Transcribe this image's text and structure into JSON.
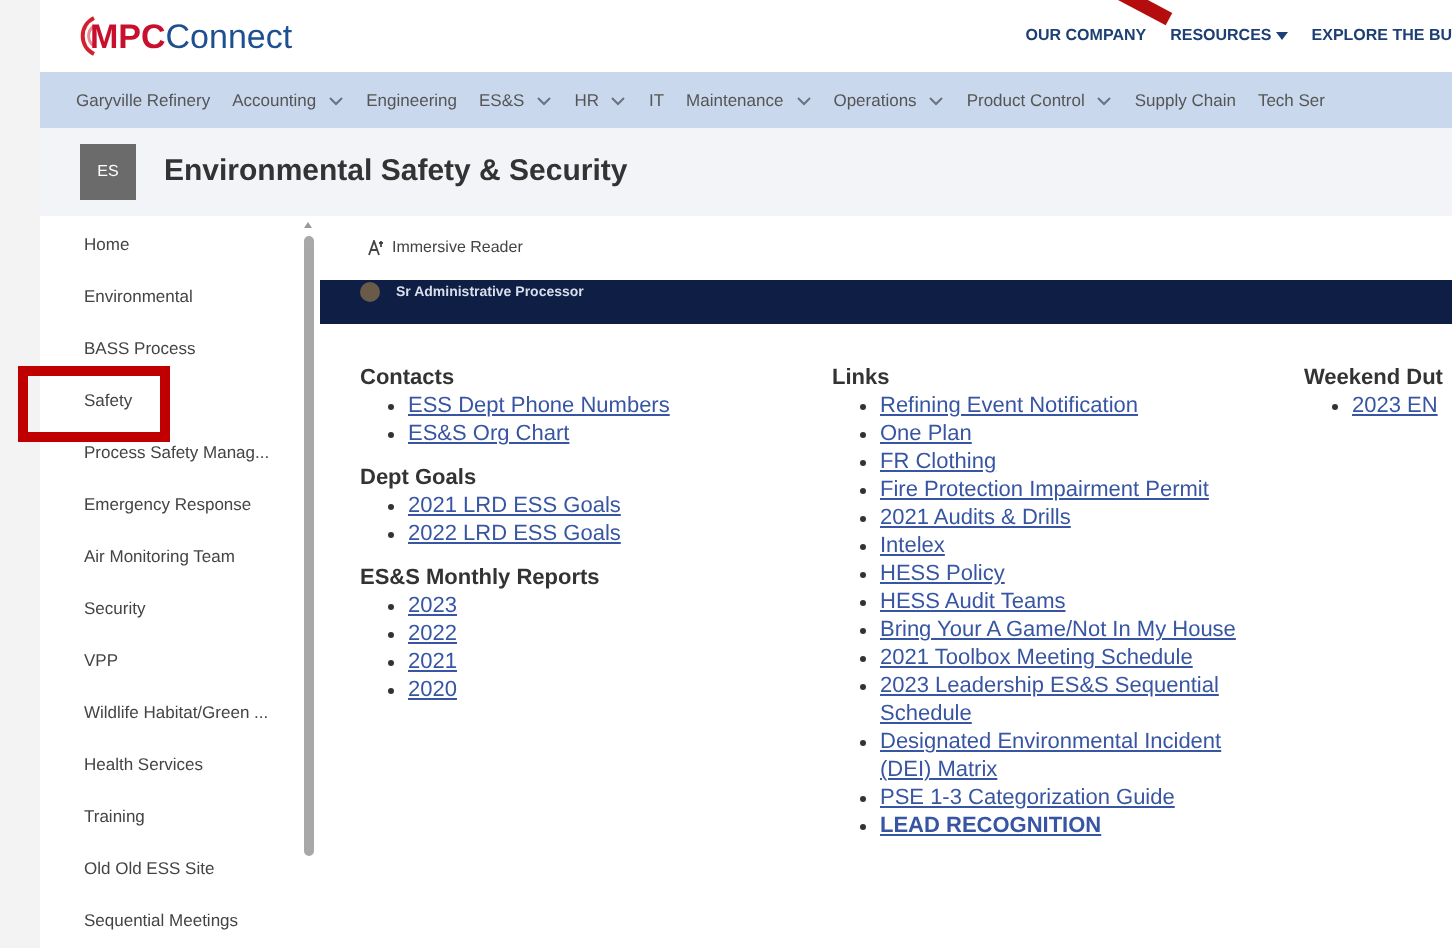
{
  "header": {
    "logo": {
      "mark": "MPC",
      "rest": "Connect"
    },
    "top_links": [
      {
        "label": "OUR COMPANY",
        "dropdown": false
      },
      {
        "label": "RESOURCES",
        "dropdown": true
      },
      {
        "label": "EXPLORE THE BU",
        "dropdown": false
      }
    ]
  },
  "nav": [
    {
      "label": "Garyville Refinery",
      "dropdown": false
    },
    {
      "label": "Accounting",
      "dropdown": true
    },
    {
      "label": "Engineering",
      "dropdown": false
    },
    {
      "label": "ES&S",
      "dropdown": true
    },
    {
      "label": "HR",
      "dropdown": true
    },
    {
      "label": "IT",
      "dropdown": false
    },
    {
      "label": "Maintenance",
      "dropdown": true
    },
    {
      "label": "Operations",
      "dropdown": true
    },
    {
      "label": "Product Control",
      "dropdown": true
    },
    {
      "label": "Supply Chain",
      "dropdown": false
    },
    {
      "label": "Tech Ser",
      "dropdown": false
    }
  ],
  "site": {
    "badge": "ES",
    "title": "Environmental Safety & Security"
  },
  "sidebar": {
    "items": [
      "Home",
      "Environmental",
      "BASS Process",
      "Safety",
      "Process Safety Manag...",
      "Emergency Response",
      "Air Monitoring Team",
      "Security",
      "VPP",
      "Wildlife Habitat/Green ...",
      "Health Services",
      "Training",
      "Old Old ESS Site",
      "Sequential Meetings"
    ]
  },
  "toolbar": {
    "immersive_reader": "Immersive Reader"
  },
  "banner": {
    "subtitle": "Sr Administrative Processor"
  },
  "columns": [
    [
      {
        "heading": "Contacts",
        "links": [
          {
            "label": "ESS Dept Phone Numbers",
            "bold": false
          },
          {
            "label": "ES&S Org Chart",
            "bold": false
          }
        ]
      },
      {
        "heading": "Dept Goals",
        "links": [
          {
            "label": "2021 LRD ESS Goals",
            "bold": false
          },
          {
            "label": "2022 LRD ESS Goals",
            "bold": false
          }
        ]
      },
      {
        "heading": "ES&S Monthly Reports",
        "links": [
          {
            "label": "2023",
            "bold": false
          },
          {
            "label": "2022",
            "bold": false
          },
          {
            "label": "2021",
            "bold": false
          },
          {
            "label": "2020",
            "bold": false
          }
        ]
      }
    ],
    [
      {
        "heading": "Links",
        "links": [
          {
            "label": "Refining Event Notification",
            "bold": false
          },
          {
            "label": "One Plan",
            "bold": false
          },
          {
            "label": "FR Clothing",
            "bold": false
          },
          {
            "label": "Fire Protection Impairment Permit",
            "bold": false
          },
          {
            "label": "2021 Audits & Drills",
            "bold": false
          },
          {
            "label": "Intelex",
            "bold": false
          },
          {
            "label": "HESS Policy",
            "bold": false
          },
          {
            "label": "HESS Audit Teams",
            "bold": false
          },
          {
            "label": "Bring Your A Game/Not In My House",
            "bold": false
          },
          {
            "label": "2021 Toolbox Meeting Schedule",
            "bold": false
          },
          {
            "label": "2023 Leadership ES&S Sequential Schedule",
            "bold": false
          },
          {
            "label": "Designated Environmental Incident (DEI) Matrix",
            "bold": false
          },
          {
            "label": "PSE 1-3 Categorization Guide",
            "bold": false
          },
          {
            "label": "LEAD RECOGNITION",
            "bold": true
          }
        ]
      }
    ],
    [
      {
        "heading": "Weekend Dut",
        "links": [
          {
            "label": "2023 EN",
            "bold": false
          }
        ]
      }
    ]
  ]
}
